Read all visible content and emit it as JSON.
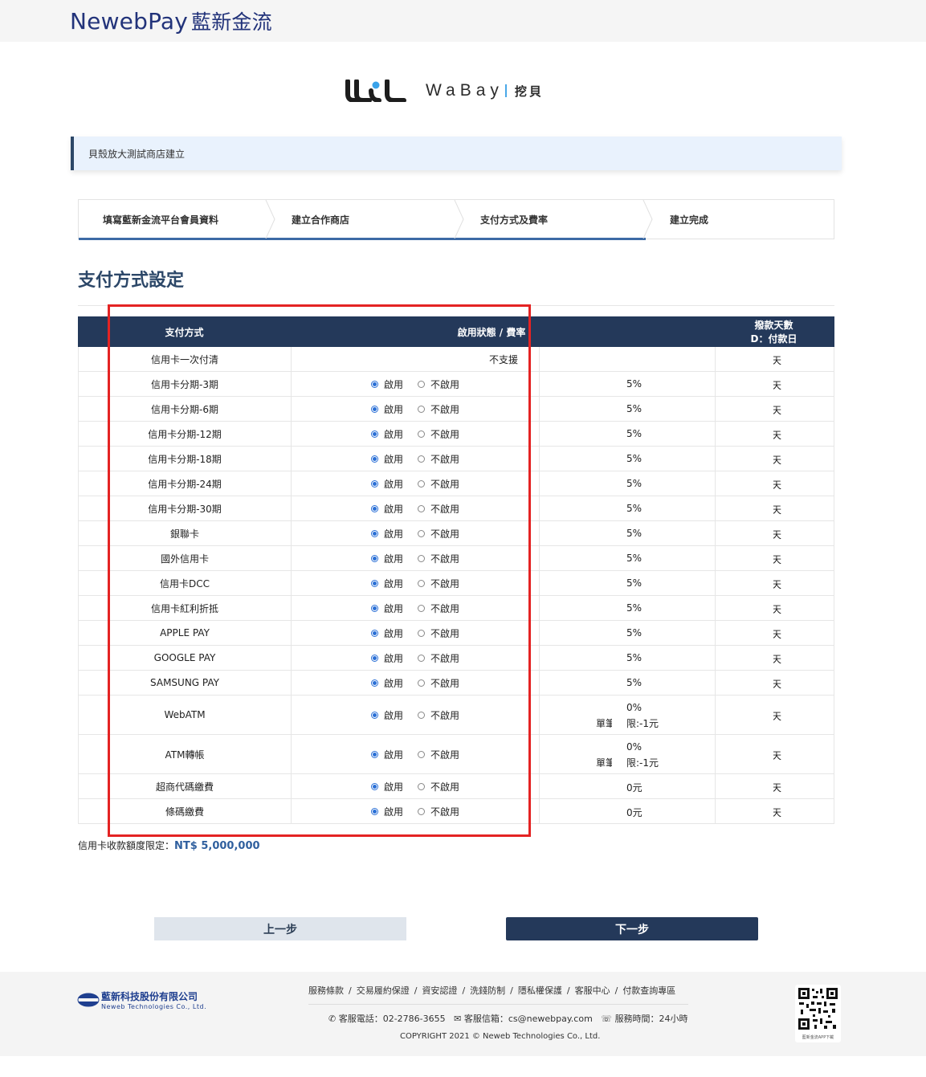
{
  "header": {
    "brand_en": "NewebPay",
    "brand_zh": "藍新金流"
  },
  "partner": {
    "name_en": "WaBay",
    "name_zh": "挖貝"
  },
  "notice": "貝殼放大測試商店建立",
  "steps": [
    {
      "label": "填寫藍新金流平台會員資料",
      "active": true
    },
    {
      "label": "建立合作商店",
      "active": true
    },
    {
      "label": "支付方式及費率",
      "active": true
    },
    {
      "label": "建立完成",
      "active": false
    }
  ],
  "section_title": "支付方式設定",
  "table": {
    "headers": {
      "method": "支付方式",
      "status_rate": "啟用狀態 / 費率",
      "days_line1": "撥款天數",
      "days_line2": "D：付款日"
    },
    "enable_label": "啟用",
    "disable_label": "不啟用",
    "rows": [
      {
        "name": "信用卡一次付清",
        "status_text": "不支援",
        "rate": "",
        "sub": "",
        "days": "天"
      },
      {
        "name": "信用卡分期-3期",
        "status_text": "",
        "rate": "5%",
        "sub": "",
        "days": "天"
      },
      {
        "name": "信用卡分期-6期",
        "status_text": "",
        "rate": "5%",
        "sub": "",
        "days": "天"
      },
      {
        "name": "信用卡分期-12期",
        "status_text": "",
        "rate": "5%",
        "sub": "",
        "days": "天"
      },
      {
        "name": "信用卡分期-18期",
        "status_text": "",
        "rate": "5%",
        "sub": "",
        "days": "天"
      },
      {
        "name": "信用卡分期-24期",
        "status_text": "",
        "rate": "5%",
        "sub": "",
        "days": "天"
      },
      {
        "name": "信用卡分期-30期",
        "status_text": "",
        "rate": "5%",
        "sub": "",
        "days": "天"
      },
      {
        "name": "銀聯卡",
        "status_text": "",
        "rate": "5%",
        "sub": "",
        "days": "天"
      },
      {
        "name": "國外信用卡",
        "status_text": "",
        "rate": "5%",
        "sub": "",
        "days": "天"
      },
      {
        "name": "信用卡DCC",
        "status_text": "",
        "rate": "5%",
        "sub": "",
        "days": "天"
      },
      {
        "name": "信用卡紅利折抵",
        "status_text": "",
        "rate": "5%",
        "sub": "",
        "days": "天"
      },
      {
        "name": "APPLE PAY",
        "status_text": "",
        "rate": "5%",
        "sub": "",
        "days": "天"
      },
      {
        "name": "GOOGLE PAY",
        "status_text": "",
        "rate": "5%",
        "sub": "",
        "days": "天"
      },
      {
        "name": "SAMSUNG PAY",
        "status_text": "",
        "rate": "5%",
        "sub": "",
        "days": "天"
      },
      {
        "name": "WebATM",
        "status_text": "",
        "rate": "0%",
        "sub_a": "單筆",
        "sub_b": "限:-1元",
        "days": "天"
      },
      {
        "name": "ATM轉帳",
        "status_text": "",
        "rate": "0%",
        "sub_a": "單筆",
        "sub_b": "限:-1元",
        "days": "天"
      },
      {
        "name": "超商代碼繳費",
        "status_text": "",
        "rate": "0元",
        "sub": "",
        "days": "天"
      },
      {
        "name": "條碼繳費",
        "status_text": "",
        "rate": "0元",
        "sub": "",
        "days": "天"
      }
    ]
  },
  "limit": {
    "label": "信用卡收款額度限定：",
    "value": "NT$ 5,000,000"
  },
  "buttons": {
    "prev": "上一步",
    "next": "下一步"
  },
  "footer": {
    "company_zh": "藍新科技股份有限公司",
    "company_en": "Neweb Technologies Co., Ltd.",
    "links": [
      "服務條款",
      "交易履約保證",
      "資安認證",
      "洗錢防制",
      "隱私權保護",
      "客服中心",
      "付款查詢專區"
    ],
    "link_separator": "/",
    "phone": "客服電話：02-2786-3655",
    "email": "客服信箱：cs@newebpay.com",
    "hours": "服務時間：24小時",
    "copyright": "COPYRIGHT 2021 © Neweb Technologies Co., Ltd.",
    "qr_caption": "藍新金流APP下載"
  },
  "colors": {
    "navy": "#24395a",
    "accent_blue": "#3c6aa5",
    "highlight_red": "#e42323",
    "radio_blue": "#2a6fd6"
  }
}
